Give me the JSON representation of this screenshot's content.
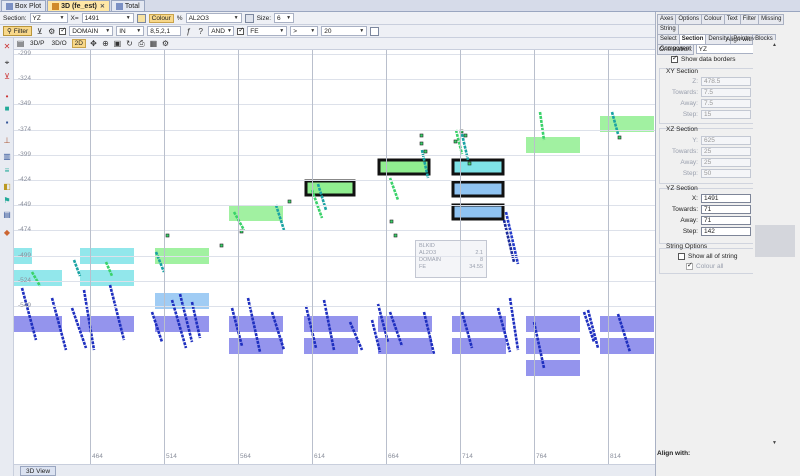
{
  "tabs": [
    {
      "label": "Box Plot",
      "icon": "box-plot-icon"
    },
    {
      "label": "3D (fe_est)",
      "icon": "3d-view-icon"
    },
    {
      "label": "Total",
      "icon": "total-icon"
    }
  ],
  "toolbar1": {
    "section_label": "Section:",
    "section_value": "YZ",
    "x_label": "X=",
    "x_value": "1491",
    "colour_label": "Colour",
    "percent": "%",
    "colour_field": "AL2O3",
    "size_label": "Size:",
    "size_value": "6"
  },
  "toolbar2": {
    "filter_label": "Filter",
    "field1": "DOMAIN",
    "op1": "IN",
    "val1": "8,5,2,1",
    "logic": "AND",
    "field2": "FE",
    "op2": ">",
    "val2": "20"
  },
  "toolbar3": {
    "btn_3dp": "3D/P",
    "btn_3do": "3D/O",
    "btn_2d": "2D"
  },
  "plot": {
    "y_ticks": [
      "-299",
      "-324",
      "-349",
      "-374",
      "-399",
      "-424",
      "-449",
      "-474",
      "-499",
      "-524",
      "-549"
    ],
    "x_ticks": [
      "464",
      "514",
      "564",
      "614",
      "664",
      "714",
      "764",
      "814"
    ],
    "tooltip": {
      "title": "BLKID",
      "rows": [
        {
          "k": "AL2O3",
          "v": "2.1"
        },
        {
          "k": "DOMAIN",
          "v": "8"
        },
        {
          "k": "FE",
          "v": "34.55"
        }
      ]
    }
  },
  "view_tab": "3D View",
  "right_panel": {
    "tabs_row1": [
      "Axes",
      "Options",
      "Colour",
      "Text",
      "Filter",
      "Missing",
      "String"
    ],
    "tabs_row2": [
      "Select",
      "Section",
      "Density",
      "Points",
      "Blocks",
      "Component"
    ],
    "active_tab": "Section",
    "align_with": "Align with:",
    "orientation_label": "Orientation:",
    "orientation_value": "YZ",
    "show_borders": "Show data borders",
    "xy_section": {
      "title": "XY Section",
      "z": "478.5",
      "towards": "7.5",
      "away": "7.5",
      "step": "15"
    },
    "xz_section": {
      "title": "XZ Section",
      "y": "625",
      "towards": "25",
      "away": "25",
      "step": "50"
    },
    "yz_section": {
      "title": "YZ Section",
      "x": "1491",
      "towards": "71",
      "away": "71",
      "step": "142"
    },
    "labels": {
      "z": "Z:",
      "y": "Y:",
      "x": "X:",
      "towards": "Towards:",
      "away": "Away:",
      "step": "Step:"
    },
    "string_options": "String Options",
    "show_all_string": "Show all of string",
    "colour_all": "Colour all",
    "footer": "Align with:"
  },
  "colors": {
    "cyan": "#7fe3e8",
    "green": "#90ee90",
    "blue_light": "#8fc3f2",
    "purple": "#8181ea",
    "dark_blue": "#1e2fbf",
    "outline": "#111111"
  }
}
